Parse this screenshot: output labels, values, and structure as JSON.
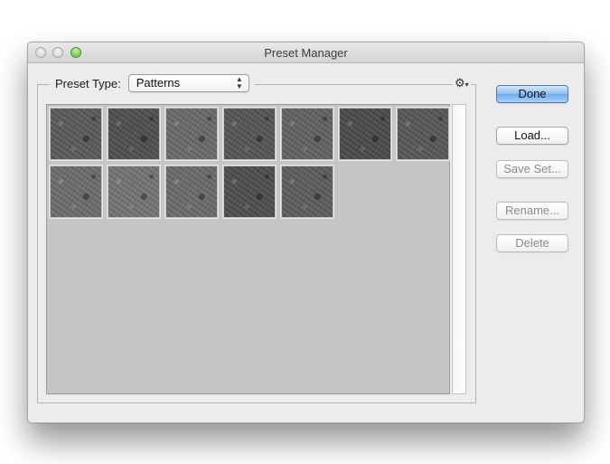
{
  "window": {
    "title": "Preset Manager"
  },
  "preset_type": {
    "label": "Preset Type:",
    "selected": "Patterns"
  },
  "patterns": {
    "count": 12,
    "texture": "dark gray rock"
  },
  "buttons": {
    "done": "Done",
    "load": "Load...",
    "save_set": "Save Set...",
    "rename": "Rename...",
    "delete": "Delete"
  },
  "icons": {
    "gear": "gear-icon",
    "select_arrows": "up-down-chevron-icon"
  },
  "colors": {
    "window_bg": "#ececec",
    "grid_bg": "#c5c5c5",
    "default_button": "#8fc0f0",
    "zoom_button": "#5fb93c"
  }
}
